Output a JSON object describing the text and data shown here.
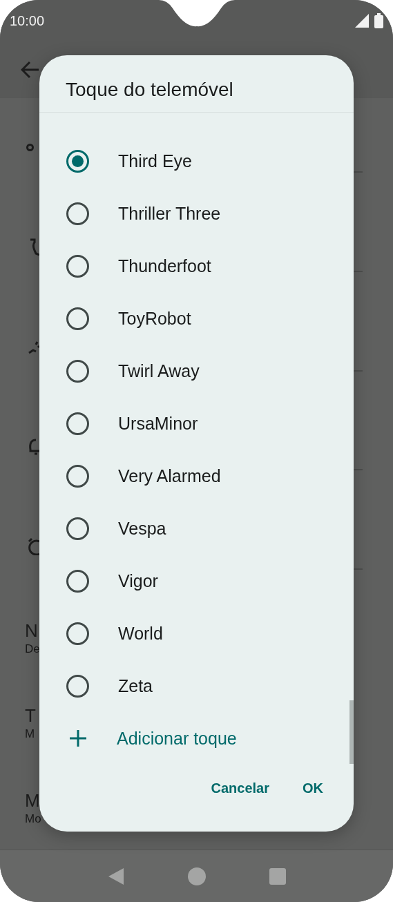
{
  "status_bar": {
    "time": "10:00"
  },
  "background": {
    "rows": [
      {
        "title": "N",
        "subtitle": "De"
      },
      {
        "title": "T",
        "subtitle": "M"
      },
      {
        "title": "M",
        "subtitle": "Mo"
      }
    ]
  },
  "dialog": {
    "title": "Toque do telemóvel",
    "options": [
      {
        "label": "Third Eye",
        "selected": true
      },
      {
        "label": "Thriller Three",
        "selected": false
      },
      {
        "label": "Thunderfoot",
        "selected": false
      },
      {
        "label": "ToyRobot",
        "selected": false
      },
      {
        "label": "Twirl Away",
        "selected": false
      },
      {
        "label": "UrsaMinor",
        "selected": false
      },
      {
        "label": "Very Alarmed",
        "selected": false
      },
      {
        "label": "Vespa",
        "selected": false
      },
      {
        "label": "Vigor",
        "selected": false
      },
      {
        "label": "World",
        "selected": false
      },
      {
        "label": "Zeta",
        "selected": false
      }
    ],
    "add_action": "Adicionar toque",
    "buttons": [
      "Cancelar",
      "OK"
    ]
  }
}
